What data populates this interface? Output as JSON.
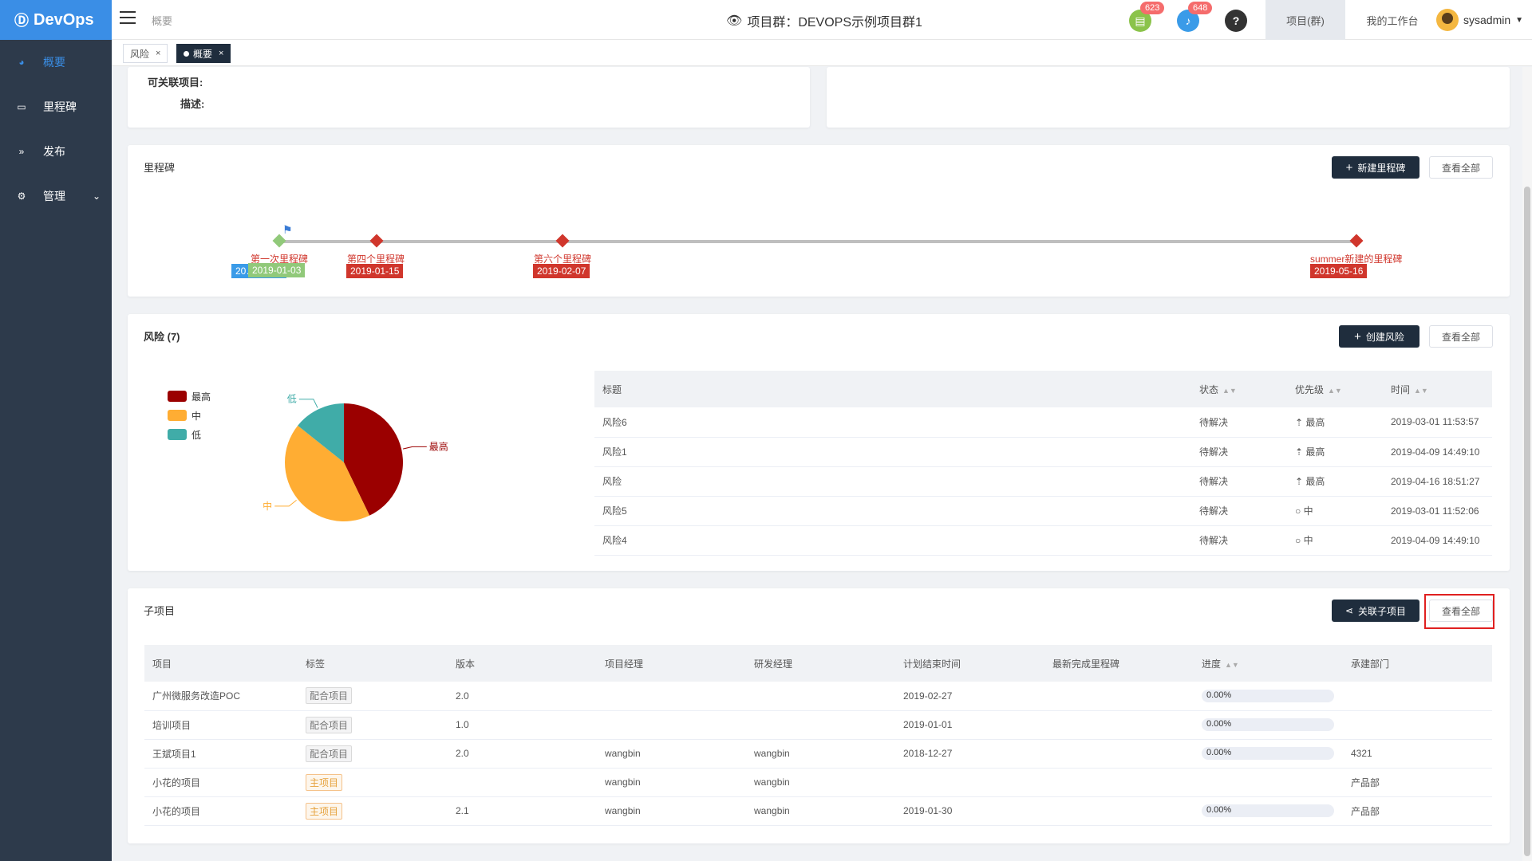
{
  "sidebar": {
    "brand": "DevOps",
    "items": [
      {
        "label": "概要",
        "icon": "dashboard-icon"
      },
      {
        "label": "里程碑",
        "icon": "folder-icon"
      },
      {
        "label": "发布",
        "icon": "forward-icon"
      },
      {
        "label": "管理",
        "icon": "gear-icon"
      }
    ]
  },
  "header": {
    "breadcrumb": "概要",
    "title": "项目群：DEVOPS示例项目群1",
    "notif_doc_count": "623",
    "notif_bell_count": "648",
    "help_glyph": "?",
    "tabs": [
      "项目(群)",
      "我的工作台"
    ],
    "username": "sysadmin"
  },
  "page_tabs": [
    {
      "label": "风险",
      "close": "×"
    },
    {
      "label": "概要",
      "close": "×"
    }
  ],
  "info": {
    "linkable_label": "可关联项目:",
    "desc_label": "描述:"
  },
  "milestones": {
    "title": "里程碑",
    "new_button": "新建里程碑",
    "view_all": "查看全部",
    "items": [
      {
        "name": "第一次里程碑",
        "date": "2019-01-03",
        "overlay_date": "20…2:02.0",
        "done": true
      },
      {
        "name": "第四个里程碑",
        "date": "2019-01-15",
        "done": false
      },
      {
        "name": "第六个里程碑",
        "date": "2019-02-07",
        "done": false
      },
      {
        "name": "summer新建的里程碑",
        "date": "2019-05-16",
        "done": false
      }
    ]
  },
  "risks": {
    "title": "风险 (7)",
    "create_button": "创建风险",
    "view_all": "查看全部",
    "legend": [
      {
        "label": "最高",
        "color": "#9b0000"
      },
      {
        "label": "中",
        "color": "#ffad33"
      },
      {
        "label": "低",
        "color": "#40aca8"
      }
    ],
    "pie_labels": {
      "high": "最高",
      "mid": "中",
      "low": "低"
    },
    "columns": [
      "标题",
      "状态",
      "优先级",
      "时间"
    ],
    "rows": [
      {
        "title": "风险6",
        "status": "待解决",
        "priority": "最高",
        "level": "high",
        "time": "2019-03-01 11:53:57"
      },
      {
        "title": "风险1",
        "status": "待解决",
        "priority": "最高",
        "level": "high",
        "time": "2019-04-09 14:49:10"
      },
      {
        "title": "风险",
        "status": "待解决",
        "priority": "最高",
        "level": "high",
        "time": "2019-04-16 18:51:27"
      },
      {
        "title": "风险5",
        "status": "待解决",
        "priority": "中",
        "level": "mid",
        "time": "2019-03-01 11:52:06"
      },
      {
        "title": "风险4",
        "status": "待解决",
        "priority": "中",
        "level": "mid",
        "time": "2019-04-09 14:49:10"
      }
    ]
  },
  "chart_data": {
    "type": "pie",
    "categories": [
      "最高",
      "中",
      "低"
    ],
    "values": [
      3,
      3,
      1
    ],
    "colors": [
      "#9b0000",
      "#ffad33",
      "#40aca8"
    ]
  },
  "subprojects": {
    "title": "子项目",
    "link_button": "关联子项目",
    "view_all": "查看全部",
    "columns": [
      "项目",
      "标签",
      "版本",
      "项目经理",
      "研发经理",
      "计划结束时间",
      "最新完成里程碑",
      "进度",
      "承建部门"
    ],
    "rows": [
      {
        "name": "广州微服务改造POC",
        "tag": "配合项目",
        "main": false,
        "version": "2.0",
        "pm": "",
        "dm": "",
        "end": "2019-02-27",
        "ms": "",
        "progress": "0.00%",
        "dept": ""
      },
      {
        "name": "培训项目",
        "tag": "配合项目",
        "main": false,
        "version": "1.0",
        "pm": "",
        "dm": "",
        "end": "2019-01-01",
        "ms": "",
        "progress": "0.00%",
        "dept": ""
      },
      {
        "name": "王斌项目1",
        "tag": "配合项目",
        "main": false,
        "version": "2.0",
        "pm": "wangbin",
        "dm": "wangbin",
        "end": "2018-12-27",
        "ms": "",
        "progress": "0.00%",
        "dept": "4321"
      },
      {
        "name": "小花的项目",
        "tag": "主项目",
        "main": true,
        "version": "",
        "pm": "wangbin",
        "dm": "wangbin",
        "end": "",
        "ms": "",
        "progress": "",
        "dept": "产品部"
      },
      {
        "name": "小花的项目",
        "tag": "主项目",
        "main": true,
        "version": "2.1",
        "pm": "wangbin",
        "dm": "wangbin",
        "end": "2019-01-30",
        "ms": "",
        "progress": "0.00%",
        "dept": "产品部"
      }
    ]
  }
}
